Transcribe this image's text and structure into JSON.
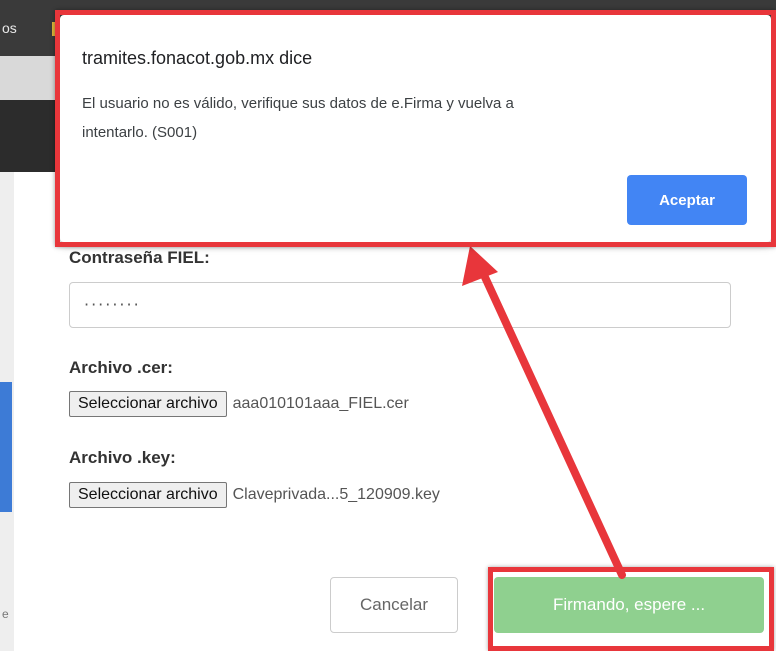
{
  "background": {
    "topbar_text": "os"
  },
  "form": {
    "password_label": "Contraseña FIEL:",
    "password_value": "········",
    "cer_label": "Archivo .cer:",
    "cer_button": "Seleccionar archivo",
    "cer_filename": "aaa010101aaa_FIEL.cer",
    "key_label": "Archivo .key:",
    "key_button": "Seleccionar archivo",
    "key_filename": "Claveprivada...5_120909.key",
    "cancel_label": "Cancelar",
    "submit_label": "Firmando, espere ..."
  },
  "alert": {
    "title": "tramites.fonacot.gob.mx dice",
    "message": "El usuario no es válido, verifique sus datos de e.Firma y vuelva a intentarlo. (S001)",
    "ok_label": "Aceptar"
  },
  "colors": {
    "annotation_red": "#e8363b",
    "alert_button_blue": "#4285f4",
    "submit_green": "#8fd08f"
  }
}
